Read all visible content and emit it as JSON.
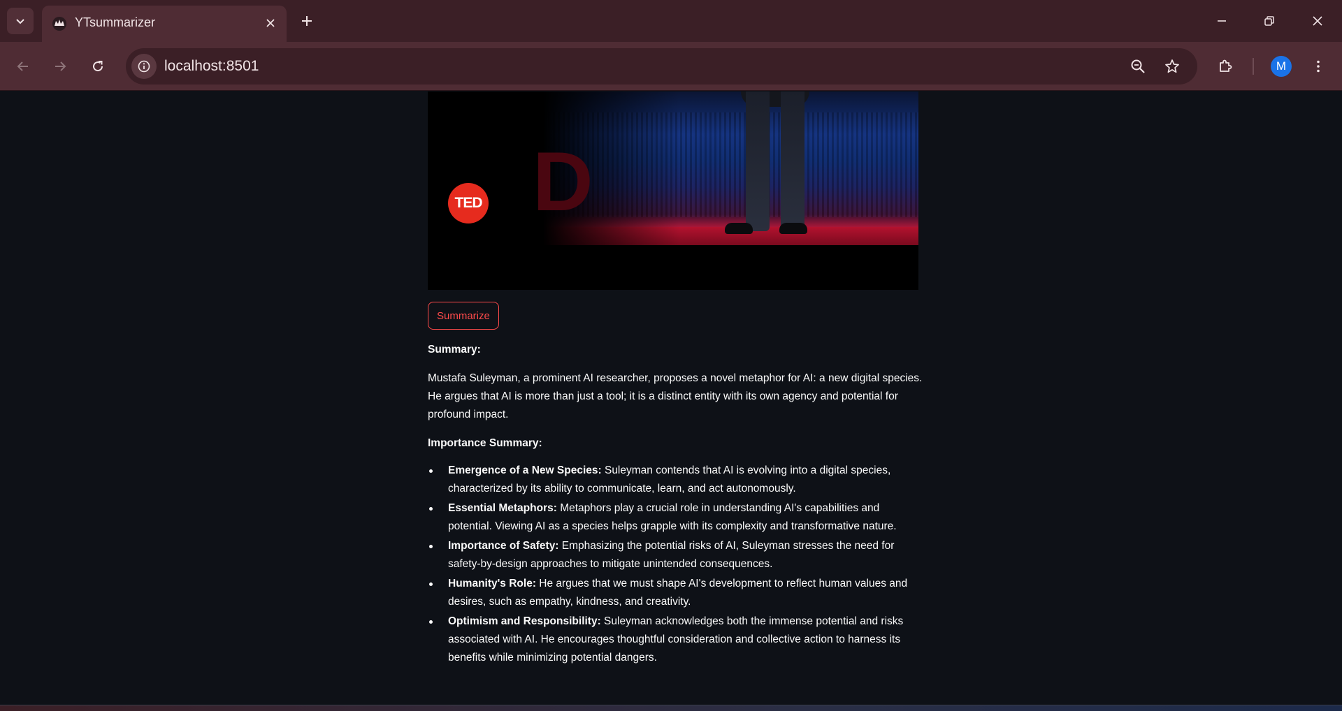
{
  "browser": {
    "tab_title": "YTsummarizer",
    "url": "localhost:8501",
    "profile_initial": "M"
  },
  "video": {
    "logo_text": "TED"
  },
  "actions": {
    "summarize_label": "Summarize"
  },
  "summary": {
    "heading": "Summary:",
    "text": "Mustafa Suleyman, a prominent AI researcher, proposes a novel metaphor for AI: a new digital species. He argues that AI is more than just a tool; it is a distinct entity with its own agency and potential for profound impact."
  },
  "importance": {
    "heading": "Importance Summary:",
    "points": [
      {
        "title": "Emergence of a New Species:",
        "text": " Suleyman contends that AI is evolving into a digital species, characterized by its ability to communicate, learn, and act autonomously."
      },
      {
        "title": "Essential Metaphors:",
        "text": " Metaphors play a crucial role in understanding AI's capabilities and potential. Viewing AI as a species helps grapple with its complexity and transformative nature."
      },
      {
        "title": "Importance of Safety:",
        "text": " Emphasizing the potential risks of AI, Suleyman stresses the need for safety-by-design approaches to mitigate unintended consequences."
      },
      {
        "title": "Humanity's Role:",
        "text": " He argues that we must shape AI's development to reflect human values and desires, such as empathy, kindness, and creativity."
      },
      {
        "title": "Optimism and Responsibility:",
        "text": " Suleyman acknowledges both the immense potential and risks associated with AI. He encourages thoughtful consideration and collective action to harness its benefits while minimizing potential dangers."
      }
    ]
  },
  "colors": {
    "accent": "#ff4b4b",
    "background": "#0e1117",
    "chrome": "#4f2c34"
  }
}
